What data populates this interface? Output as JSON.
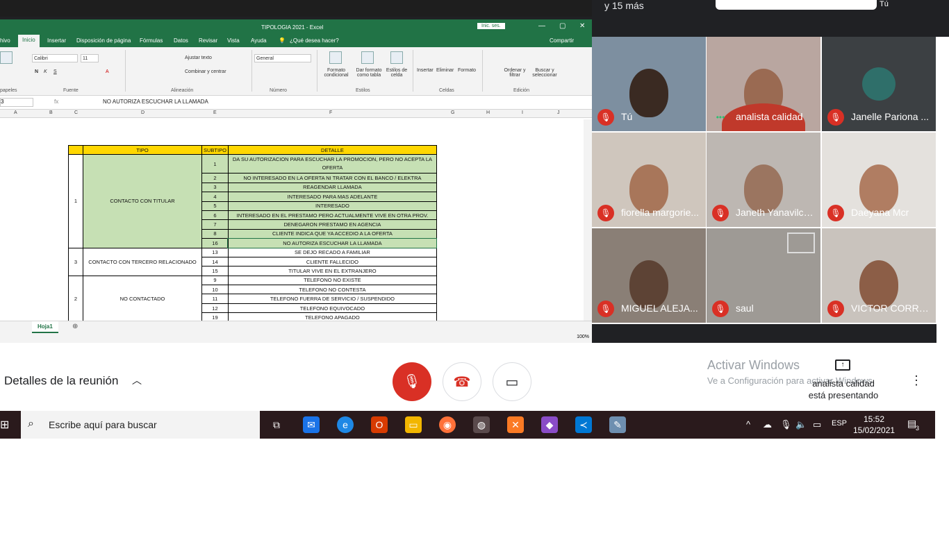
{
  "top_bar": {
    "people_text": "y 15 más",
    "self_label": "Tú"
  },
  "excel": {
    "window_title": "TIPOLOGIA 2021 - Excel",
    "login_button": "Inic. ses.",
    "tabs": [
      "hivo",
      "Inicio",
      "Insertar",
      "Disposición de página",
      "Fórmulas",
      "Datos",
      "Revisar",
      "Vista",
      "Ayuda",
      "¿Qué desea hacer?"
    ],
    "share_label": "Compartir",
    "ribbon": {
      "font_name": "Calibri",
      "font_size": "11",
      "wrap_text": "Ajustar texto",
      "merge_center": "Combinar y centrar",
      "number_format": "General",
      "cond_format": "Formato condicional",
      "format_table": "Dar formato como tabla",
      "cell_styles": "Estilos de celda",
      "insert": "Insertar",
      "delete": "Eliminar",
      "format": "Formato",
      "sort_filter": "Ordenar y filtrar",
      "find_select": "Buscar y seleccionar",
      "groups": [
        "papeles",
        "Fuente",
        "Alineación",
        "Número",
        "Estilos",
        "Celdas",
        "Edición"
      ]
    },
    "formula_bar": {
      "cell_ref": "3",
      "fx": "fx",
      "formula": "NO AUTORIZA ESCUCHAR LA LLAMADA"
    },
    "columns": [
      "A",
      "B",
      "C",
      "D",
      "E",
      "F",
      "G",
      "H",
      "I",
      "J"
    ],
    "table_headers": [
      "TIPO",
      "SUBTIPO",
      "DETALLE"
    ],
    "groups": [
      {
        "id": "1",
        "tipo": "CONTACTO CON TITULAR",
        "rows": [
          {
            "sub": "1",
            "detalle": "DA SU AUTORIZACION PARA ESCUCHAR LA PROMOCION, PERO NO ACEPTA LA OFERTA"
          },
          {
            "sub": "2",
            "detalle": "NO INTERESADO EN LA OFERTA NI TRATAR CON EL BANCO / ELEKTRA"
          },
          {
            "sub": "3",
            "detalle": "REAGENDAR LLAMADA"
          },
          {
            "sub": "4",
            "detalle": "INTERESADO PARA MAS ADELANTE"
          },
          {
            "sub": "5",
            "detalle": "INTERESADO"
          },
          {
            "sub": "6",
            "detalle": "INTERESADO EN EL PRESTAMO PERO ACTUALMENTE VIVE EN OTRA PROV."
          },
          {
            "sub": "7",
            "detalle": "DENEGARON PRESTAMO EN AGENCIA"
          },
          {
            "sub": "8",
            "detalle": "CLIENTE INDICA QUE YA ACCEDIO A LA OFERTA"
          },
          {
            "sub": "16",
            "detalle": "NO AUTORIZA ESCUCHAR LA LLAMADA"
          }
        ]
      },
      {
        "id": "3",
        "tipo": "CONTACTO CON TERCERO RELACIONADO",
        "rows": [
          {
            "sub": "13",
            "detalle": "SE DEJO RECADO A FAMILIAR"
          },
          {
            "sub": "14",
            "detalle": "CLIENTE FALLECIDO"
          },
          {
            "sub": "15",
            "detalle": "TITULAR VIVE EN EL EXTRANJERO"
          }
        ]
      },
      {
        "id": "2",
        "tipo": "NO CONTACTADO",
        "rows": [
          {
            "sub": "9",
            "detalle": "TELEFONO NO EXISTE"
          },
          {
            "sub": "10",
            "detalle": "TELEFONO NO CONTESTA"
          },
          {
            "sub": "11",
            "detalle": "TELEFONO FUERRA DE SERVICIO / SUSPENDIDO"
          },
          {
            "sub": "12",
            "detalle": "TELEFONO EQUIVOCADO"
          },
          {
            "sub": "19",
            "detalle": "TELEFONO APAGADO"
          }
        ]
      }
    ],
    "sheet_tab": "Hoja1",
    "zoom": "100%"
  },
  "participants": [
    {
      "name": "Tú",
      "muted": true
    },
    {
      "name": "analista calidad",
      "muted": false
    },
    {
      "name": "Janelle Pariona ...",
      "muted": true
    },
    {
      "name": "fiorella margorie...",
      "muted": true
    },
    {
      "name": "Janeth Yanavilca...",
      "muted": true
    },
    {
      "name": "Daeyana Mcr",
      "muted": true
    },
    {
      "name": "MIGUEL ALEJA...",
      "muted": true
    },
    {
      "name": "saul",
      "muted": true
    },
    {
      "name": "VICTOR CORREA",
      "muted": true
    }
  ],
  "meet": {
    "details_label": "Detalles de la reunión",
    "activate_title": "Activar Windows",
    "activate_sub": "Ve a Configuración para activar Windows.",
    "presenting": "analista calidad está presentando"
  },
  "taskbar": {
    "search_placeholder": "Escribe aquí para buscar",
    "lang": "ESP",
    "time": "15:52",
    "date": "15/02/2021",
    "notif_count": "3"
  },
  "colors": {
    "excel_green": "#217346",
    "header_yellow": "#ffd700",
    "row_green": "#c6e0b4",
    "meet_red": "#d93025",
    "taskbar": "#2a1a1c"
  }
}
